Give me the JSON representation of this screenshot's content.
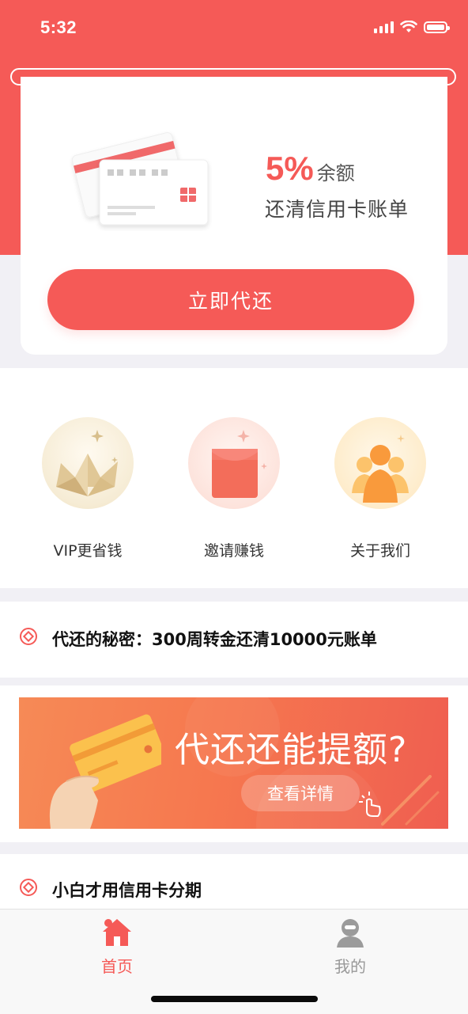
{
  "status_bar": {
    "time": "5:32"
  },
  "promo": {
    "percent": "5%",
    "unit": "余额",
    "subtitle": "还清信用卡账单",
    "button_label": "立即代还"
  },
  "quick_actions": [
    {
      "label": "VIP更省钱",
      "icon": "crown-icon"
    },
    {
      "label": "邀请赚钱",
      "icon": "red-envelope-icon"
    },
    {
      "label": "关于我们",
      "icon": "team-icon"
    }
  ],
  "articles": [
    {
      "title": "代还的秘密：300周转金还清10000元账单"
    },
    {
      "title": "小白才用信用卡分期"
    }
  ],
  "banner": {
    "title": "代还还能提额?",
    "button_label": "查看详情"
  },
  "tabbar": {
    "items": [
      {
        "label": "首页",
        "icon": "home-icon",
        "active": true
      },
      {
        "label": "我的",
        "icon": "user-icon",
        "active": false
      }
    ]
  },
  "colors": {
    "accent": "#f55a57",
    "inactive": "#999999"
  }
}
